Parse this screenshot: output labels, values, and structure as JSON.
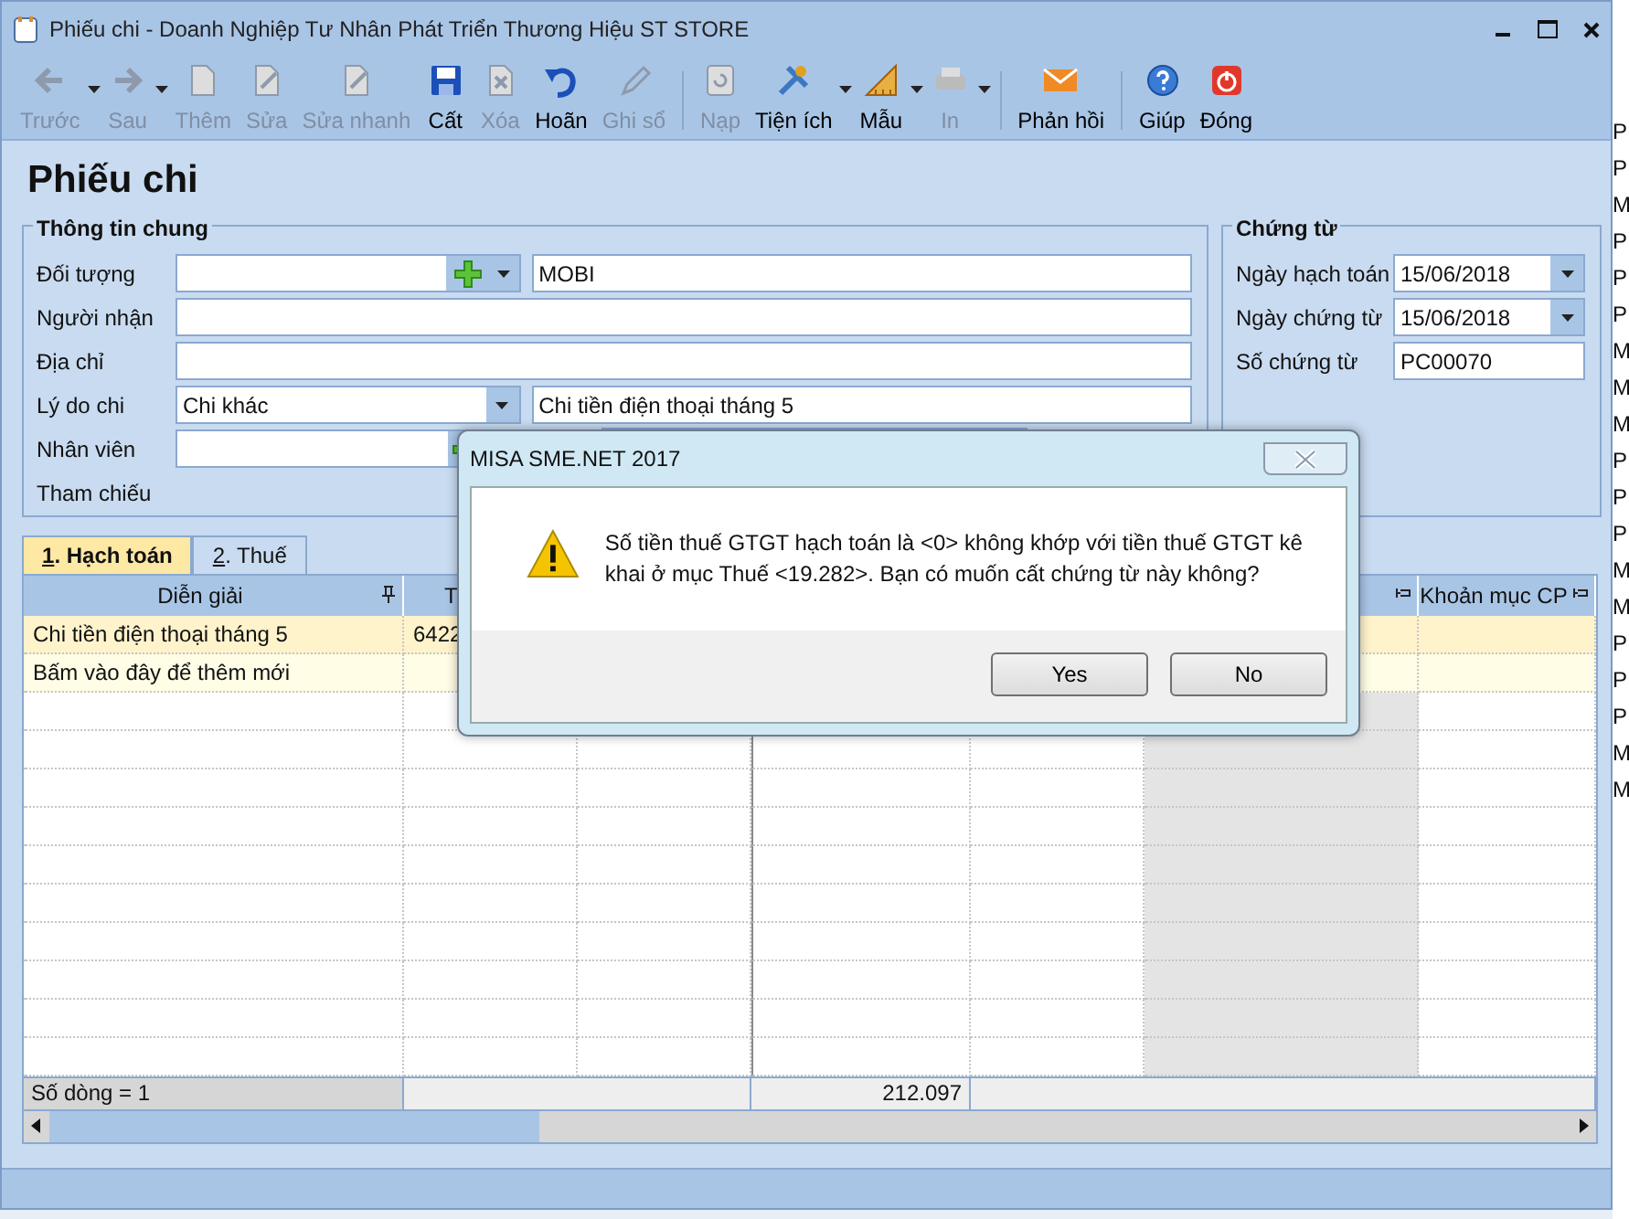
{
  "window": {
    "title": "Phiếu chi - Doanh Nghiệp Tư Nhân Phát Triển Thương Hiệu ST STORE"
  },
  "toolbar": [
    {
      "label": "Trước",
      "disabled": true,
      "dropdown": true
    },
    {
      "label": "Sau",
      "disabled": true,
      "dropdown": true
    },
    {
      "label": "Thêm",
      "disabled": true,
      "dropdown": false
    },
    {
      "label": "Sửa",
      "disabled": true,
      "dropdown": false
    },
    {
      "label": "Sửa nhanh",
      "disabled": true,
      "dropdown": false
    },
    {
      "label": "Cất",
      "disabled": false,
      "dropdown": false
    },
    {
      "label": "Xóa",
      "disabled": true,
      "dropdown": false
    },
    {
      "label": "Hoãn",
      "disabled": false,
      "dropdown": false
    },
    {
      "label": "Ghi sổ",
      "disabled": true,
      "dropdown": false,
      "separator_after": true
    },
    {
      "label": "Nạp",
      "disabled": true,
      "dropdown": false
    },
    {
      "label": "Tiện ích",
      "disabled": false,
      "dropdown": true
    },
    {
      "label": "Mẫu",
      "disabled": false,
      "dropdown": true
    },
    {
      "label": "In",
      "disabled": true,
      "dropdown": true,
      "separator_after": true
    },
    {
      "label": "Phản hồi",
      "disabled": false,
      "dropdown": false,
      "separator_after": true
    },
    {
      "label": "Giúp",
      "disabled": false,
      "dropdown": false
    },
    {
      "label": "Đóng",
      "disabled": false,
      "dropdown": false
    }
  ],
  "form_title": "Phiếu chi",
  "general": {
    "title": "Thông tin chung",
    "rows": [
      {
        "label": "Đối tượng",
        "kind": "lookup",
        "value": "",
        "extra": "MOBI"
      },
      {
        "label": "Người nhận",
        "kind": "text",
        "value": ""
      },
      {
        "label": "Địa chỉ",
        "kind": "text",
        "value": ""
      },
      {
        "label": "Lý do chi",
        "kind": "select",
        "value": "Chi khác",
        "extra": "Chi tiền điện thoại tháng 5"
      },
      {
        "label": "Nhân viên",
        "kind": "lookup_partial",
        "value": ""
      },
      {
        "label": "Tham chiếu",
        "kind": "label"
      }
    ]
  },
  "voucher": {
    "title": "Chứng từ",
    "rows": [
      {
        "label": "Ngày hạch toán",
        "kind": "date",
        "value": "15/06/2018"
      },
      {
        "label": "Ngày chứng từ",
        "kind": "date",
        "value": "15/06/2018"
      },
      {
        "label": "Số chứng từ",
        "kind": "text",
        "value": "PC00070"
      }
    ]
  },
  "tabs": [
    {
      "label": "1. Hạch toán",
      "selected": true
    },
    {
      "label": "2. Thuế",
      "selected": false
    }
  ],
  "grid": {
    "columns": [
      {
        "header": "Diễn giải",
        "pin": true
      },
      {
        "header": "T",
        "pin": false
      },
      {},
      {},
      {},
      {
        "pin": true,
        "shaded": true
      },
      {
        "header": "Khoản mục CP",
        "pin": true
      }
    ],
    "rows": [
      {
        "cells": [
          "Chi tiền điện thoại tháng 5",
          "6422"
        ],
        "kind": "data"
      },
      {
        "cells": [
          "Bấm vào đây để thêm mới"
        ],
        "kind": "new"
      }
    ],
    "footer": {
      "row_count": "Số dòng = 1",
      "total": "212.097"
    }
  },
  "background_list": [
    "P",
    "P",
    "M",
    "P",
    "P",
    "P",
    "M",
    "M",
    "M",
    "P",
    "P",
    "P",
    "M",
    "M",
    "P",
    "P",
    "P",
    "M",
    "M"
  ],
  "dialog": {
    "title": "MISA SME.NET 2017",
    "message": "Số tiền thuế GTGT hạch toán là <0> không khớp với tiền thuế GTGT kê khai ở mục Thuế <19.282>. Bạn có muốn cất chứng từ này không?",
    "buttons": [
      "Yes",
      "No"
    ]
  }
}
